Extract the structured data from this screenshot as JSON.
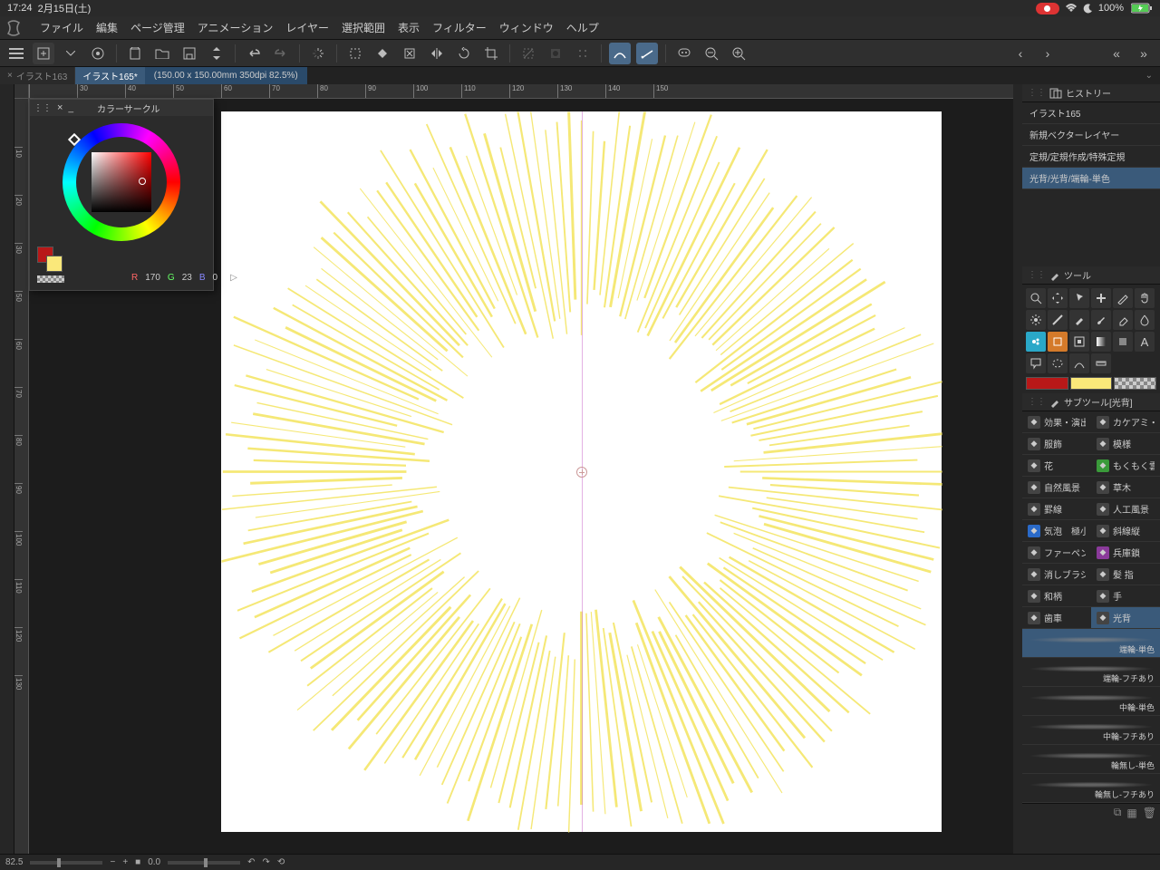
{
  "status": {
    "time": "17:24",
    "date": "2月15日(土)",
    "battery_pct": "100%"
  },
  "menu": {
    "items": [
      "ファイル",
      "編集",
      "ページ管理",
      "アニメーション",
      "レイヤー",
      "選択範囲",
      "表示",
      "フィルター",
      "ウィンドウ",
      "ヘルプ"
    ]
  },
  "tabs": {
    "inactive": "イラスト163",
    "active": "イラスト165*",
    "info": "(150.00 x 150.00mm 350dpi 82.5%)"
  },
  "color_panel": {
    "title": "カラーサークル",
    "r_label": "R",
    "g_label": "G",
    "b_label": "B",
    "r": "170",
    "g": "23",
    "b": "0",
    "fg": "#b81818",
    "bg": "#fae87a"
  },
  "history": {
    "title": "ヒストリー",
    "items": [
      "イラスト165",
      "新規ベクターレイヤー",
      "定規/定規作成/特殊定規",
      "光背/光背/端輪-単色"
    ],
    "selected": 3
  },
  "tools": {
    "title": "ツール"
  },
  "subtool": {
    "title": "サブツール[光背]",
    "cats": [
      {
        "l": "効果・演出"
      },
      {
        "l": "カケアミ・"
      },
      {
        "l": "服飾"
      },
      {
        "l": "模様"
      },
      {
        "l": "花"
      },
      {
        "l": "もくもく雲"
      },
      {
        "l": "自然風景"
      },
      {
        "l": "草木"
      },
      {
        "l": "罫線"
      },
      {
        "l": "人工風景"
      },
      {
        "l": "気泡　極小"
      },
      {
        "l": "斜線縦"
      },
      {
        "l": "ファーペン"
      },
      {
        "l": "兵庫鎖"
      },
      {
        "l": "消しブラシ"
      },
      {
        "l": "髪 指"
      },
      {
        "l": "和柄"
      },
      {
        "l": "手"
      },
      {
        "l": "歯車"
      },
      {
        "l": "光背"
      }
    ],
    "brushes": [
      "端輪-単色",
      "端輪-フチあり",
      "中輪-単色",
      "中輪-フチあり",
      "輪無し-単色",
      "輪無し-フチあり"
    ],
    "selected_brush": 0
  },
  "ruler_h": [
    "",
    "30",
    "40",
    "50",
    "60",
    "70",
    "80",
    "90",
    "100",
    "110",
    "120",
    "130",
    "140",
    "150"
  ],
  "ruler_v": [
    "",
    "10",
    "20",
    "30",
    "50",
    "60",
    "70",
    "80",
    "90",
    "100",
    "110",
    "120",
    "130"
  ],
  "bottom": {
    "zoom": "82.5",
    "angle": "0.0"
  }
}
